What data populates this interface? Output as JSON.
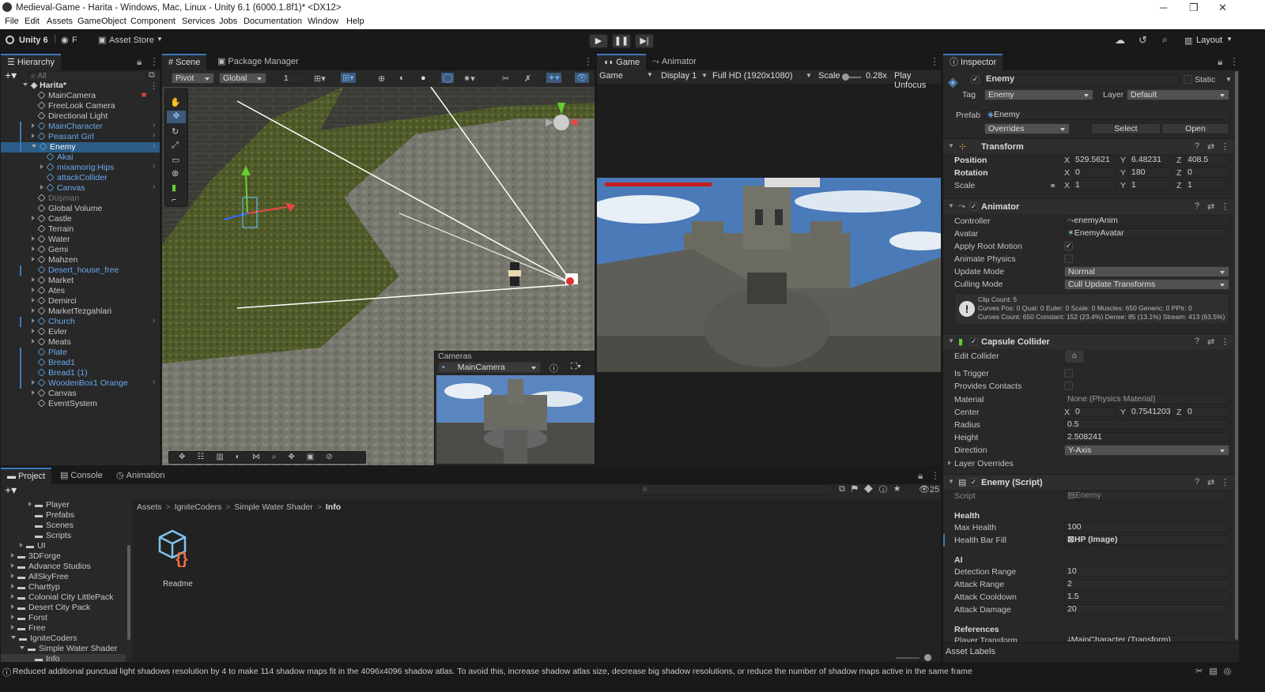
{
  "window": {
    "title": "Medieval-Game - Harita - Windows, Mac, Linux - Unity 6.1 (6000.1.8f1)* <DX12>",
    "minimize": "─",
    "maximize": "❐",
    "close": "✕"
  },
  "menu": [
    "File",
    "Edit",
    "Assets",
    "GameObject",
    "Component",
    "Services",
    "Jobs",
    "Documentation",
    "Window",
    "Help"
  ],
  "toolbar": {
    "unity_label": "Unity 6",
    "account": "F",
    "asset_store": "Asset Store",
    "layout": "Layout"
  },
  "hierarchy": {
    "tab": "Hierarchy",
    "search_placeholder": "All",
    "scene": "Harita*",
    "items": [
      {
        "label": "MainCamera",
        "depth": 1,
        "blue": false,
        "exp": "none"
      },
      {
        "label": "FreeLook Camera",
        "depth": 1,
        "blue": false,
        "exp": "none"
      },
      {
        "label": "Directional Light",
        "depth": 1,
        "blue": false,
        "exp": "none"
      },
      {
        "label": "MainCharacter",
        "depth": 1,
        "blue": true,
        "exp": "right"
      },
      {
        "label": "Peasant Girl",
        "depth": 1,
        "blue": true,
        "exp": "right"
      },
      {
        "label": "Enemy",
        "depth": 1,
        "blue": true,
        "exp": "down",
        "selected": true
      },
      {
        "label": "Akai",
        "depth": 2,
        "blue": true,
        "exp": "none"
      },
      {
        "label": "mixamorig:Hips",
        "depth": 2,
        "blue": true,
        "exp": "right"
      },
      {
        "label": "attackCollider",
        "depth": 2,
        "blue": true,
        "exp": "none"
      },
      {
        "label": "Canvas",
        "depth": 2,
        "blue": true,
        "exp": "right"
      },
      {
        "label": "Düşman",
        "depth": 1,
        "blue": false,
        "exp": "none",
        "dim": true
      },
      {
        "label": "Global Volume",
        "depth": 1,
        "blue": false,
        "exp": "none"
      },
      {
        "label": "Castle",
        "depth": 1,
        "blue": false,
        "exp": "right"
      },
      {
        "label": "Terrain",
        "depth": 1,
        "blue": false,
        "exp": "none"
      },
      {
        "label": "Water",
        "depth": 1,
        "blue": false,
        "exp": "right"
      },
      {
        "label": "Gemi",
        "depth": 1,
        "blue": false,
        "exp": "right"
      },
      {
        "label": "Mahzen",
        "depth": 1,
        "blue": false,
        "exp": "right"
      },
      {
        "label": "Desert_house_free",
        "depth": 1,
        "blue": true,
        "exp": "none"
      },
      {
        "label": "Market",
        "depth": 1,
        "blue": false,
        "exp": "right"
      },
      {
        "label": "Ates",
        "depth": 1,
        "blue": false,
        "exp": "right"
      },
      {
        "label": "Demirci",
        "depth": 1,
        "blue": false,
        "exp": "right"
      },
      {
        "label": "MarketTezgahlari",
        "depth": 1,
        "blue": false,
        "exp": "right"
      },
      {
        "label": "Church",
        "depth": 1,
        "blue": true,
        "exp": "right"
      },
      {
        "label": "Evler",
        "depth": 1,
        "blue": false,
        "exp": "right"
      },
      {
        "label": "Meats",
        "depth": 1,
        "blue": false,
        "exp": "right"
      },
      {
        "label": "Plate",
        "depth": 1,
        "blue": true,
        "exp": "none"
      },
      {
        "label": "Bread1",
        "depth": 1,
        "blue": true,
        "exp": "none"
      },
      {
        "label": "Bread1 (1)",
        "depth": 1,
        "blue": true,
        "exp": "none"
      },
      {
        "label": "WoodenBox1 Orange",
        "depth": 1,
        "blue": true,
        "exp": "right"
      },
      {
        "label": "Canvas",
        "depth": 1,
        "blue": false,
        "exp": "right"
      },
      {
        "label": "EventSystem",
        "depth": 1,
        "blue": false,
        "exp": "none"
      }
    ]
  },
  "scene": {
    "tab_scene": "Scene",
    "tab_package": "Package Manager",
    "pivot": "Pivot",
    "global": "Global",
    "grid_value": "1",
    "cameras_title": "Cameras",
    "camera_select": "MainCamera"
  },
  "game": {
    "tab_game": "Game",
    "tab_animator": "Animator",
    "mode": "Game",
    "display": "Display 1",
    "resolution": "Full HD (1920x1080)",
    "scale_label": "Scale",
    "scale_value": "0.28x",
    "play_unfocused": "Play Unfocus"
  },
  "inspector": {
    "tab": "Inspector",
    "name": "Enemy",
    "static_label": "Static",
    "tag_label": "Tag",
    "tag": "Enemy",
    "layer_label": "Layer",
    "layer": "Default",
    "prefab_label": "Prefab",
    "prefab": "Enemy",
    "overrides": "Overrides",
    "select": "Select",
    "open": "Open",
    "transform": {
      "title": "Transform",
      "position_label": "Position",
      "rotation_label": "Rotation",
      "scale_label": "Scale",
      "position": {
        "x": "529.5621",
        "y": "6.48231",
        "z": "408.5"
      },
      "rotation": {
        "x": "0",
        "y": "180",
        "z": "0"
      },
      "scale": {
        "x": "1",
        "y": "1",
        "z": "1"
      }
    },
    "animator": {
      "title": "Animator",
      "controller_label": "Controller",
      "controller": "enemyAnim",
      "avatar_label": "Avatar",
      "avatar": "EnemyAvatar",
      "apply_root_motion": "Apply Root Motion",
      "animate_physics": "Animate Physics",
      "update_mode_label": "Update Mode",
      "update_mode": "Normal",
      "culling_mode_label": "Culling Mode",
      "culling_mode": "Cull Update Transforms",
      "info1": "Clip Count: 5",
      "info2": "Curves Pos: 0 Quat: 0 Euler: 0 Scale: 0 Muscles: 650 Generic: 0 PPtr: 0",
      "info3": "Curves Count: 650 Constant: 152 (23.4%) Dense: 85 (13.1%) Stream: 413 (63.5%)"
    },
    "capsule": {
      "title": "Capsule Collider",
      "edit_label": "Edit Collider",
      "is_trigger": "Is Trigger",
      "provides_contacts": "Provides Contacts",
      "material_label": "Material",
      "material": "None (Physics Material)",
      "center_label": "Center",
      "center": {
        "x": "0",
        "y": "0.7541203",
        "z": "0"
      },
      "radius_label": "Radius",
      "radius": "0.5",
      "height_label": "Height",
      "height": "2.508241",
      "direction_label": "Direction",
      "direction": "Y-Axis",
      "layer_overrides": "Layer Overrides"
    },
    "script": {
      "title": "Enemy (Script)",
      "script_label": "Script",
      "script": "Enemy",
      "health_header": "Health",
      "max_health_label": "Max Health",
      "max_health": "100",
      "hbfill_label": "Health Bar Fill",
      "hbfill": "HP (Image)",
      "ai_header": "AI",
      "detection_label": "Detection Range",
      "detection": "10",
      "attack_range_label": "Attack Range",
      "attack_range": "2",
      "cooldown_label": "Attack Cooldown",
      "cooldown": "1.5",
      "damage_label": "Attack Damage",
      "damage": "20",
      "refs_header": "References",
      "player_label": "Player Transform",
      "player": "MainCharacter (Transform)"
    },
    "asset_labels": "Asset Labels"
  },
  "project": {
    "tab_project": "Project",
    "tab_console": "Console",
    "tab_animation": "Animation",
    "count": "25",
    "tree": [
      {
        "label": "Player",
        "depth": 3,
        "exp": "right"
      },
      {
        "label": "Prefabs",
        "depth": 3,
        "exp": "none"
      },
      {
        "label": "Scenes",
        "depth": 3,
        "exp": "none"
      },
      {
        "label": "Scripts",
        "depth": 3,
        "exp": "none"
      },
      {
        "label": "UI",
        "depth": 2,
        "exp": "right"
      },
      {
        "label": "3DForge",
        "depth": 1,
        "exp": "right"
      },
      {
        "label": "Advance Studios",
        "depth": 1,
        "exp": "right"
      },
      {
        "label": "AllSkyFree",
        "depth": 1,
        "exp": "right"
      },
      {
        "label": "Charttyp",
        "depth": 1,
        "exp": "right"
      },
      {
        "label": "Colonial City LittlePack",
        "depth": 1,
        "exp": "right"
      },
      {
        "label": "Desert City Pack",
        "depth": 1,
        "exp": "right"
      },
      {
        "label": "Forst",
        "depth": 1,
        "exp": "right"
      },
      {
        "label": "Free",
        "depth": 1,
        "exp": "right"
      },
      {
        "label": "IgniteCoders",
        "depth": 1,
        "exp": "down"
      },
      {
        "label": "Simple Water Shader",
        "depth": 2,
        "exp": "down"
      },
      {
        "label": "Info",
        "depth": 3,
        "exp": "none",
        "selected": true
      }
    ],
    "breadcrumb": [
      "Assets",
      "IgniteCoders",
      "Simple Water Shader",
      "Info"
    ],
    "asset_name": "Readme"
  },
  "status": {
    "message": "Reduced additional punctual light shadows resolution by 4 to make 114 shadow maps fit in the 4096x4096 shadow atlas. To avoid this, increase shadow atlas size, decrease big shadow resolutions, or reduce the number of shadow maps active in the same frame"
  },
  "colors": {
    "accent": "#3a79bb",
    "prefab_blue": "#69aaf0",
    "panel": "#282828",
    "background": "#191919"
  }
}
